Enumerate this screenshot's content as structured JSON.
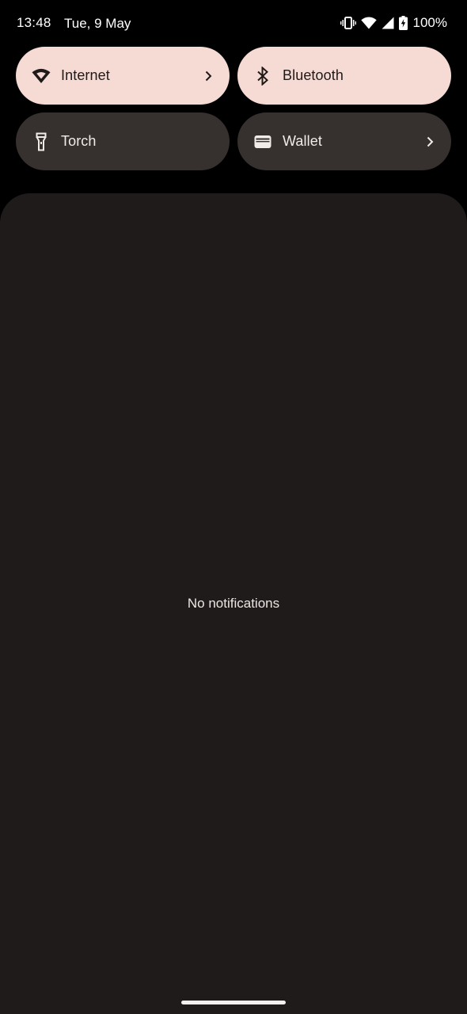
{
  "status_bar": {
    "time": "13:48",
    "date": "Tue, 9 May",
    "battery_percent": "100%",
    "icons": [
      "vibrate-icon",
      "wifi-icon",
      "cell-signal-icon",
      "battery-charging-icon"
    ]
  },
  "quick_settings": {
    "tiles": [
      {
        "label": "Internet",
        "icon": "wifi-icon",
        "state": "on",
        "has_chevron": true
      },
      {
        "label": "Bluetooth",
        "icon": "bluetooth-icon",
        "state": "on",
        "has_chevron": false
      },
      {
        "label": "Torch",
        "icon": "flashlight-icon",
        "state": "off",
        "has_chevron": false
      },
      {
        "label": "Wallet",
        "icon": "wallet-icon",
        "state": "off",
        "has_chevron": true
      }
    ]
  },
  "notifications": {
    "empty_text": "No notifications"
  },
  "colors": {
    "background": "#000000",
    "tile_active": "#f6dad4",
    "tile_inactive": "#36302f",
    "panel": "#201b1b"
  }
}
